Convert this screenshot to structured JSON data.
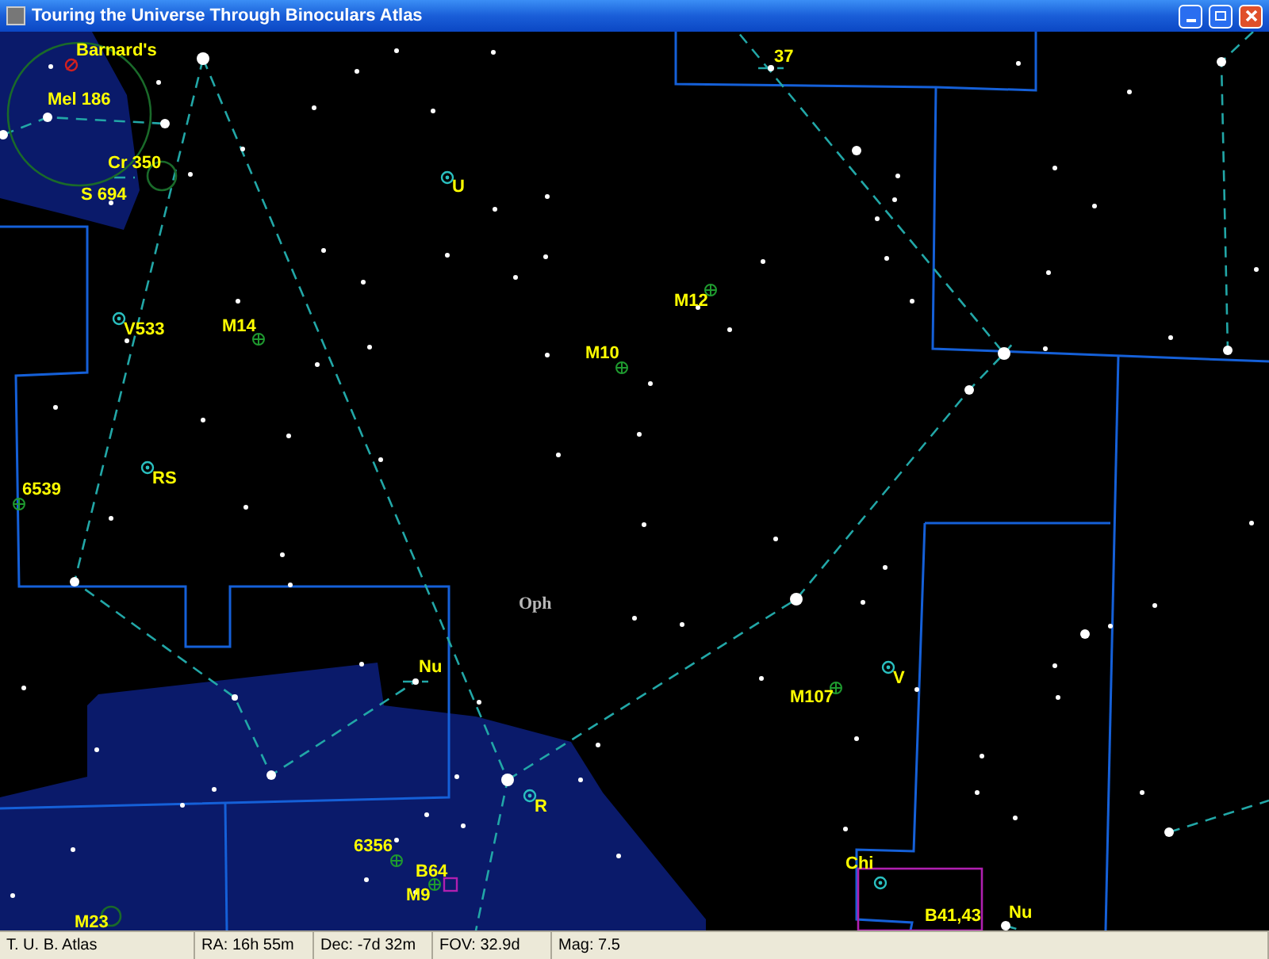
{
  "window": {
    "title": "Touring the Universe Through Binoculars Atlas"
  },
  "map_labels": [
    {
      "text": "Barnard's",
      "kind": "object"
    },
    {
      "text": "Mel 186",
      "kind": "object"
    },
    {
      "text": "Cr 350",
      "kind": "object"
    },
    {
      "text": "S 694",
      "kind": "object"
    },
    {
      "text": "U",
      "kind": "object"
    },
    {
      "text": "37",
      "kind": "object"
    },
    {
      "text": "M12",
      "kind": "object"
    },
    {
      "text": "V533",
      "kind": "object"
    },
    {
      "text": "M14",
      "kind": "object"
    },
    {
      "text": "M10",
      "kind": "object"
    },
    {
      "text": "6539",
      "kind": "object"
    },
    {
      "text": "RS",
      "kind": "object"
    },
    {
      "text": "Oph",
      "kind": "constellation"
    },
    {
      "text": "Nu",
      "kind": "object"
    },
    {
      "text": "V",
      "kind": "object"
    },
    {
      "text": "M107",
      "kind": "object"
    },
    {
      "text": "R",
      "kind": "object"
    },
    {
      "text": "6356",
      "kind": "object"
    },
    {
      "text": "B64",
      "kind": "object"
    },
    {
      "text": "Chi",
      "kind": "object"
    },
    {
      "text": "M9",
      "kind": "object"
    },
    {
      "text": "M23",
      "kind": "object"
    },
    {
      "text": "B41,43",
      "kind": "object"
    },
    {
      "text": "Nu",
      "kind": "object"
    }
  ],
  "status_bar": [
    "T. U. B. Atlas",
    "RA: 16h 55m",
    "Dec: -7d 32m",
    "FOV: 32.9d",
    "Mag: 7.5"
  ]
}
